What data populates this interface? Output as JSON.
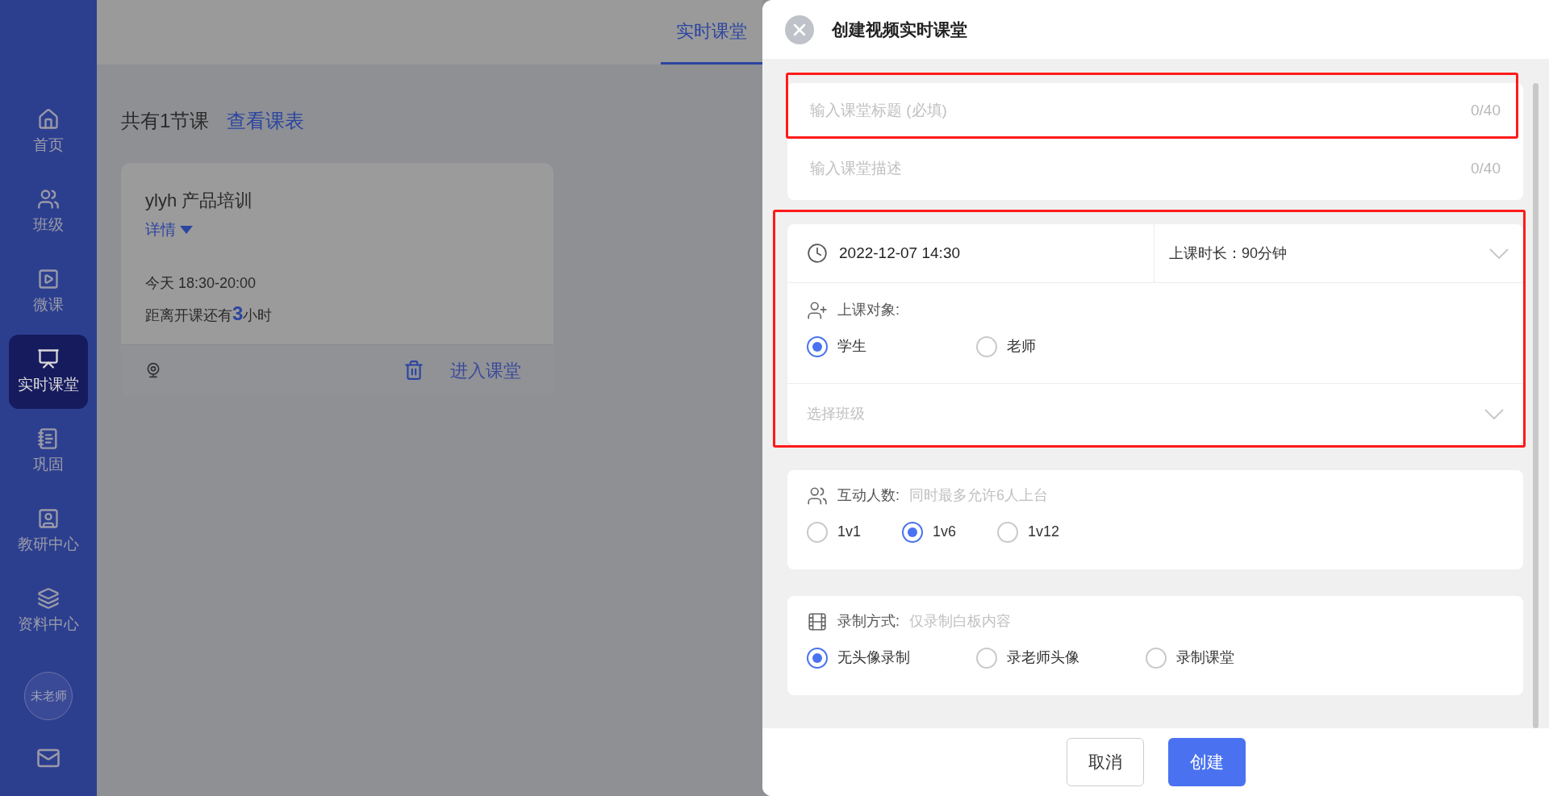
{
  "sidebar": {
    "items": [
      {
        "label": "首页",
        "selected": false
      },
      {
        "label": "班级",
        "selected": false
      },
      {
        "label": "微课",
        "selected": false
      },
      {
        "label": "实时课堂",
        "selected": true
      },
      {
        "label": "巩固",
        "selected": false
      },
      {
        "label": "教研中心",
        "selected": false
      },
      {
        "label": "资料中心",
        "selected": false
      }
    ],
    "avatar": "未老师"
  },
  "header": {
    "tabs": [
      {
        "label": "实时课堂",
        "selected": true
      }
    ]
  },
  "summary": {
    "count": "共有1节课",
    "link": "查看课表"
  },
  "lesson_card": {
    "title": "ylyh 产品培训",
    "details": "详情",
    "time": "今天 18:30-20:00",
    "countdown_prefix": "距离开课还有",
    "countdown_value": "3",
    "countdown_suffix": "小时",
    "enter": "进入课堂"
  },
  "modal": {
    "title": "创建视频实时课堂",
    "fields": [
      {
        "placeholder": "输入课堂标题 (必填)",
        "counter": "0/40",
        "highlighted": true
      },
      {
        "placeholder": "输入课堂描述",
        "counter": "0/40",
        "highlighted": false
      }
    ],
    "schedule": {
      "start": "2022-12-07 14:30",
      "duration": "上课时长：90分钟",
      "audience_label": "上课对象:",
      "audience": [
        {
          "label": "学生",
          "selected": true
        },
        {
          "label": "老师",
          "selected": false
        }
      ],
      "class_placeholder": "选择班级",
      "highlighted": true
    },
    "interaction": {
      "label": "互动人数:",
      "hint": "同时最多允许6人上台",
      "options": [
        {
          "label": "1v1",
          "selected": false
        },
        {
          "label": "1v6",
          "selected": true
        },
        {
          "label": "1v12",
          "selected": false
        }
      ]
    },
    "recording": {
      "label": "录制方式:",
      "hint": "仅录制白板内容",
      "options": [
        {
          "label": "无头像录制",
          "selected": true
        },
        {
          "label": "录老师头像",
          "selected": false
        },
        {
          "label": "录制课堂",
          "selected": false
        }
      ]
    },
    "buttons": {
      "cancel": "取消",
      "create": "创建"
    }
  }
}
